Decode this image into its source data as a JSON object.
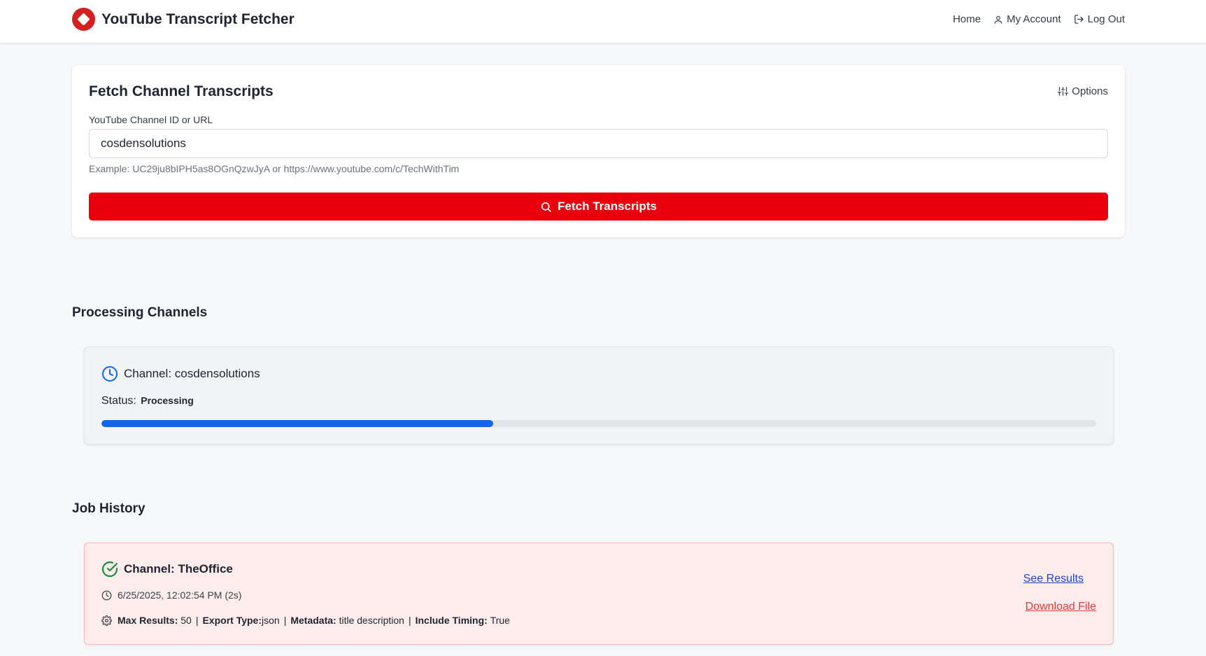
{
  "header": {
    "title": "YouTube Transcript Fetcher",
    "nav": {
      "home": "Home",
      "account": "My Account",
      "logout": "Log Out"
    }
  },
  "fetch": {
    "title": "Fetch Channel Transcripts",
    "options_label": "Options",
    "field_label": "YouTube Channel ID or URL",
    "input_value": "cosdensolutions",
    "hint": "Example: UC29ju8bIPH5as8OGnQzwJyA or https://www.youtube.com/c/TechWithTim",
    "button_label": "Fetch Transcripts"
  },
  "processing": {
    "section_title": "Processing Channels",
    "channel_prefix": "Channel:",
    "channel_name": "cosdensolutions",
    "status_label": "Status:",
    "status_value": "Processing",
    "progress_fraction": 0.394
  },
  "history": {
    "section_title": "Job History",
    "job": {
      "channel": "Channel: TheOffice",
      "timestamp": "6/25/2025, 12:02:54 PM (2s)",
      "max_results_label": "Max Results:",
      "max_results_value": "50",
      "export_type_label": "Export Type:",
      "export_type_value": "json",
      "metadata_label": "Metadata:",
      "metadata_value": "title description",
      "timing_label": "Include Timing:",
      "timing_value": "True",
      "see_results": "See Results",
      "download_file": "Download File"
    }
  },
  "colors": {
    "accent_red": "#e8000d",
    "progress_blue": "#1565e8",
    "success_green": "#1e8a3a",
    "link_blue": "#1a44c9",
    "link_red": "#e53935"
  },
  "icons": [
    "logo-icon",
    "user-icon",
    "logout-icon",
    "sliders-icon",
    "search-icon",
    "clock-icon",
    "check-circle-icon",
    "gear-icon"
  ]
}
